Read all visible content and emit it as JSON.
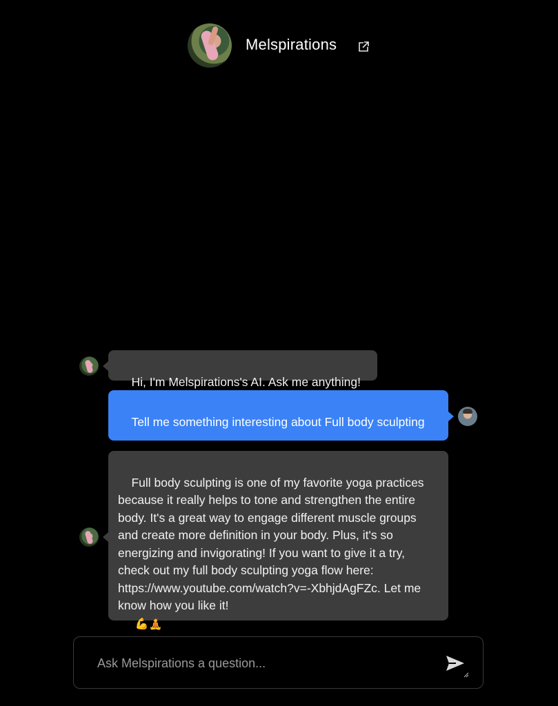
{
  "header": {
    "title": "Melspirations",
    "avatar_icon": "profile-avatar",
    "external_link_icon": "external-link-icon"
  },
  "messages": [
    {
      "role": "ai",
      "text": "Hi, I'm Melspirations's AI. Ask me anything!"
    },
    {
      "role": "user",
      "text": "Tell me something interesting about Full body sculpting"
    },
    {
      "role": "ai",
      "text": "Full body sculpting is one of my favorite yoga practices because it really helps to tone and strengthen the entire body. It's a great way to engage different muscle groups and create more definition in your body. Plus, it's so energizing and invigorating! If you want to give it a try, check out my full body sculpting yoga flow here: https://www.youtube.com/watch?v=-XbhjdAgFZc. Let me know how you like it!",
      "emojis": "💪🧘"
    }
  ],
  "input": {
    "placeholder": "Ask Melspirations a question...",
    "value": ""
  },
  "colors": {
    "background": "#000000",
    "ai_bubble": "#3d3d3d",
    "user_bubble": "#3b82f6",
    "text": "#f2f2f2"
  }
}
